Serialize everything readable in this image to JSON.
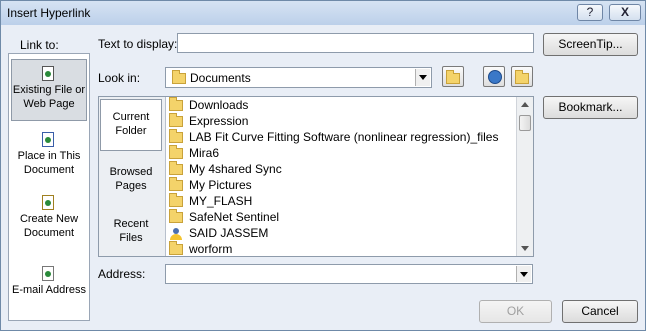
{
  "window": {
    "title": "Insert Hyperlink",
    "help_label": "?",
    "close_label": "X"
  },
  "link_to": {
    "label": "Link to:",
    "items": [
      {
        "label_line1": "Existing File or",
        "label_line2": "Web Page",
        "icon": "web-page-icon"
      },
      {
        "label_line1": "Place in This",
        "label_line2": "Document",
        "icon": "document-place-icon"
      },
      {
        "label_line1": "Create New",
        "label_line2": "Document",
        "icon": "new-document-icon"
      },
      {
        "label_line1": "E-mail Address",
        "label_line2": "",
        "icon": "email-icon"
      }
    ]
  },
  "text_to_display": {
    "label": "Text to display:",
    "value": ""
  },
  "screentip_button": "ScreenTip...",
  "look_in": {
    "label": "Look in:",
    "value": "Documents"
  },
  "bookmark_button": "Bookmark...",
  "browse_tabs": [
    {
      "line1": "Current",
      "line2": "Folder"
    },
    {
      "line1": "Browsed",
      "line2": "Pages"
    },
    {
      "line1": "Recent",
      "line2": "Files"
    }
  ],
  "files": [
    "Downloads",
    "Expression",
    "LAB Fit Curve Fitting Software (nonlinear regression)_files",
    "Mira6",
    "My 4shared Sync",
    "My Pictures",
    "MY_FLASH",
    "SafeNet Sentinel",
    "SAID JASSEM",
    "worform"
  ],
  "address": {
    "label": "Address:",
    "value": ""
  },
  "ok_button": "OK",
  "cancel_button": "Cancel"
}
